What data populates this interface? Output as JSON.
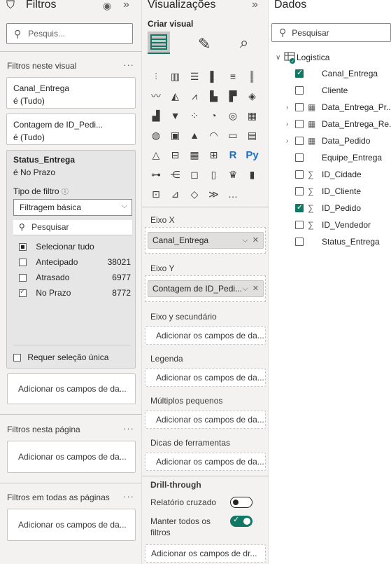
{
  "filters": {
    "title": "Filtros",
    "search_placeholder": "Pesquis...",
    "on_visual_label": "Filtros neste visual",
    "cards": [
      {
        "name": "Canal_Entrega",
        "value": "é (Tudo)"
      },
      {
        "name": "Contagem de ID_Pedi...",
        "value": "é (Tudo)"
      }
    ],
    "status": {
      "name": "Status_Entrega",
      "value": "é No Prazo",
      "filter_type_label": "Tipo de filtro",
      "filter_type_value": "Filtragem básica",
      "search_placeholder": "Pesquisar",
      "select_all": "Selecionar tudo",
      "items": [
        {
          "label": "Antecipado",
          "count": "38021",
          "checked": false
        },
        {
          "label": "Atrasado",
          "count": "6977",
          "checked": false
        },
        {
          "label": "No Prazo",
          "count": "8772",
          "checked": true
        }
      ],
      "single_select": "Requer seleção única"
    },
    "add_fields": "Adicionar os campos de da...",
    "on_page_label": "Filtros nesta página",
    "all_pages_label": "Filtros em todas as páginas"
  },
  "viz": {
    "title": "Visualizações",
    "build_label": "Criar visual",
    "x_axis_label": "Eixo X",
    "x_axis_field": "Canal_Entrega",
    "y_axis_label": "Eixo Y",
    "y_axis_field": "Contagem de ID_Pedi...",
    "secondary_label": "Eixo y secundário",
    "add_fields": "Adicionar os campos de da...",
    "legend_label": "Legenda",
    "small_multiples_label": "Múltiplos pequenos",
    "tooltips_label": "Dicas de ferramentas",
    "drill_label": "Drill-through",
    "cross_report_label": "Relatório cruzado",
    "keep_filters_label_1": "Manter todos os",
    "keep_filters_label_2": "filtros",
    "add_drill_fields": "Adicionar os campos de dr..."
  },
  "data": {
    "title": "Dados",
    "search_placeholder": "Pesquisar",
    "table_name": "Logistica",
    "fields": [
      {
        "label": "Canal_Entrega",
        "checked": true,
        "icon": "",
        "expand": false
      },
      {
        "label": "Cliente",
        "checked": false,
        "icon": "",
        "expand": false
      },
      {
        "label": "Data_Entrega_Pr...",
        "checked": false,
        "icon": "calendar",
        "expand": true
      },
      {
        "label": "Data_Entrega_Re...",
        "checked": false,
        "icon": "calendar",
        "expand": true
      },
      {
        "label": "Data_Pedido",
        "checked": false,
        "icon": "calendar",
        "expand": true
      },
      {
        "label": "Equipe_Entrega",
        "checked": false,
        "icon": "",
        "expand": false
      },
      {
        "label": "ID_Cidade",
        "checked": false,
        "icon": "sigma",
        "expand": false
      },
      {
        "label": "ID_Cliente",
        "checked": false,
        "icon": "sigma",
        "expand": false
      },
      {
        "label": "ID_Pedido",
        "checked": true,
        "icon": "sigma",
        "expand": false
      },
      {
        "label": "ID_Vendedor",
        "checked": false,
        "icon": "sigma",
        "expand": false
      },
      {
        "label": "Status_Entrega",
        "checked": false,
        "icon": "",
        "expand": false
      }
    ]
  },
  "colors": {
    "accent": "#117865",
    "pane_bg": "#f3f2f1"
  }
}
